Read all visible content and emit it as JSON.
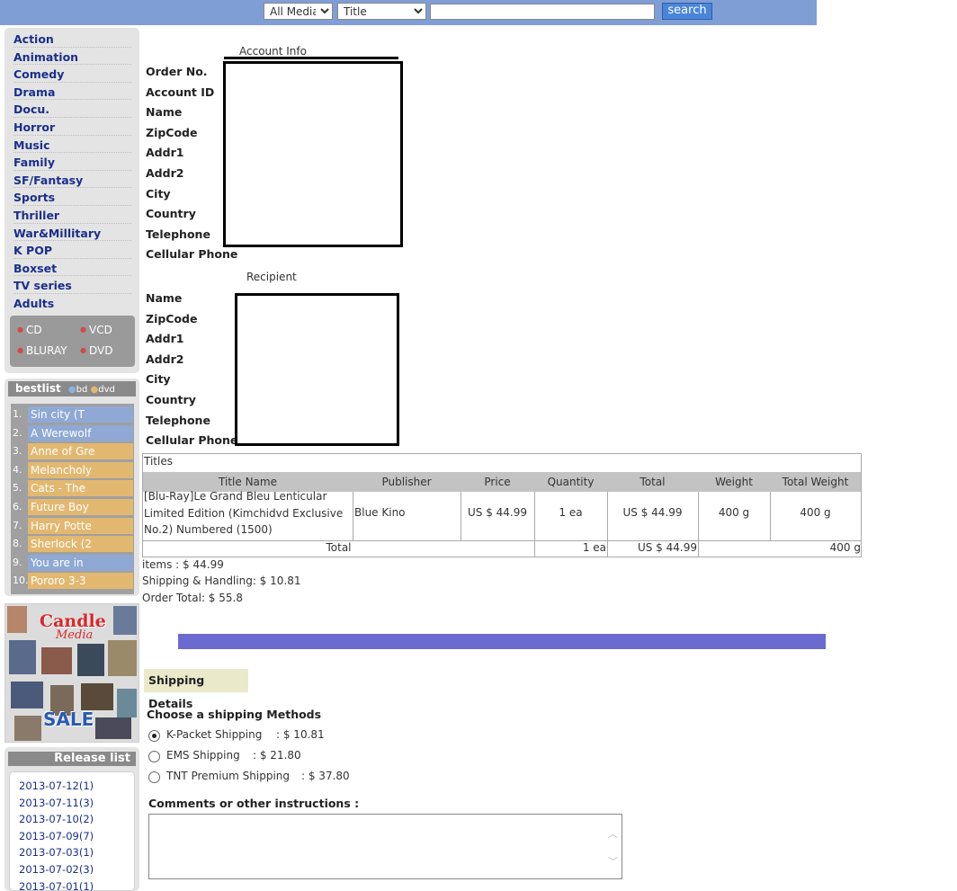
{
  "search": {
    "media_selected": "All Media",
    "field_selected": "Title",
    "query": "",
    "button_label": "search"
  },
  "genres": [
    "Action",
    "Animation",
    "Comedy",
    "Drama",
    "Docu.",
    "Horror",
    "Music",
    "Family",
    "SF/Fantasy",
    "Sports",
    "Thriller",
    "War&Millitary",
    "K POP",
    "Boxset",
    "TV series",
    "Adults"
  ],
  "media_formats": [
    "CD",
    "VCD",
    "BLURAY",
    "DVD"
  ],
  "bestlist": {
    "title": "bestlist",
    "tag_bd": "bd",
    "tag_dvd": "dvd",
    "colors": {
      "bd": "#8fa8d4",
      "dvd": "#e2b870"
    },
    "items": [
      {
        "rank": "1.",
        "label": "Sin city (T",
        "type": "bd"
      },
      {
        "rank": "2.",
        "label": "A Werewolf",
        "type": "bd"
      },
      {
        "rank": "3.",
        "label": "Anne of Gre",
        "type": "dvd"
      },
      {
        "rank": "4.",
        "label": "Melancholy",
        "type": "dvd"
      },
      {
        "rank": "5.",
        "label": "Cats - The",
        "type": "dvd"
      },
      {
        "rank": "6.",
        "label": "Future Boy",
        "type": "dvd"
      },
      {
        "rank": "7.",
        "label": "Harry Potte",
        "type": "dvd"
      },
      {
        "rank": "8.",
        "label": "Sherlock (2",
        "type": "dvd"
      },
      {
        "rank": "9.",
        "label": "You are in",
        "type": "bd"
      },
      {
        "rank": "10.",
        "label": "Pororo 3-3",
        "type": "dvd"
      }
    ]
  },
  "banner": {
    "line1": "Candle",
    "line2": "Media",
    "line3": "SALE"
  },
  "release_list": {
    "title": "Release list",
    "items": [
      "2013-07-12(1)",
      "2013-07-11(3)",
      "2013-07-10(2)",
      "2013-07-09(7)",
      "2013-07-03(1)",
      "2013-07-02(3)",
      "2013-07-01(1)"
    ]
  },
  "account": {
    "section_title": "Account Info",
    "labels": [
      "Order No.",
      "Account ID",
      "Name",
      "ZipCode",
      "Addr1",
      "Addr2",
      "City",
      "Country",
      "Telephone",
      "Cellular Phone"
    ]
  },
  "recipient": {
    "section_title": "Recipient",
    "labels": [
      "Name",
      "ZipCode",
      "Addr1",
      "Addr2",
      "City",
      "Country",
      "Telephone",
      "Cellular Phone"
    ]
  },
  "order_table": {
    "caption": "Titles",
    "headers": [
      "Title Name",
      "Publisher",
      "Price",
      "Quantity",
      "Total",
      "Weight",
      "Total Weight"
    ],
    "rows": [
      {
        "title_line1": "[Blu-Ray]Le Grand Bleu Lenticular",
        "title_line2": "Limited Edition (Kimchidvd Exclusive",
        "title_line3": "No.2) Numbered (1500)",
        "publisher": "Blue Kino",
        "price": "US $ 44.99",
        "quantity": "1 ea",
        "total": "US $ 44.99",
        "weight": "400 g",
        "total_weight": "400 g"
      }
    ],
    "totals": {
      "label": "Total",
      "quantity": "1 ea",
      "total": "US $ 44.99",
      "total_weight": "400 g"
    }
  },
  "summary": {
    "items": "items : $ 44.99",
    "shipping": "Shipping & Handling: $ 10.81",
    "order_total": "Order Total: $ 55.8"
  },
  "shipping": {
    "section_title": "Shipping Details",
    "choose_label": "Choose a shipping Methods",
    "options": [
      {
        "name": "K-Packet Shipping",
        "price": ": $ 10.81",
        "selected": true
      },
      {
        "name": "EMS Shipping",
        "price": ": $ 21.80",
        "selected": false
      },
      {
        "name": "TNT Premium Shipping",
        "price": ": $ 37.80",
        "selected": false
      }
    ]
  },
  "comments": {
    "label": "Comments or other instructions :",
    "value": ""
  }
}
